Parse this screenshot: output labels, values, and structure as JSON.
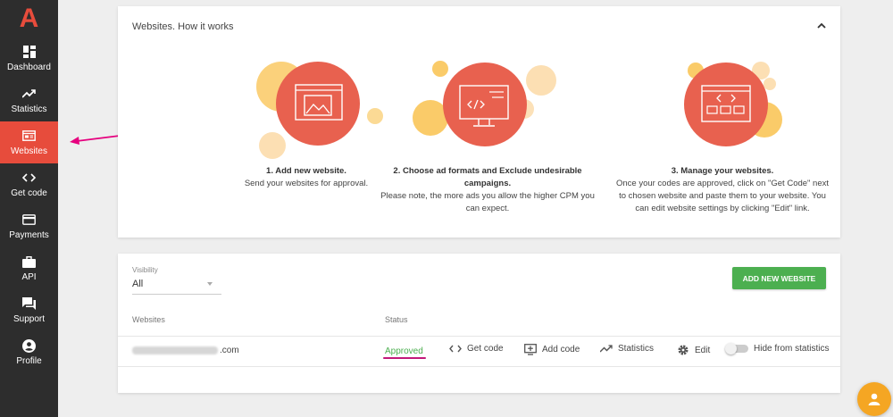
{
  "brand": {
    "logo_letter": "A",
    "accent": "#e74c3c"
  },
  "sidebar": {
    "items": [
      {
        "label": "Dashboard",
        "icon": "dashboard-icon",
        "active": false
      },
      {
        "label": "Statistics",
        "icon": "statistics-icon",
        "active": false
      },
      {
        "label": "Websites",
        "icon": "websites-icon",
        "active": true
      },
      {
        "label": "Get code",
        "icon": "code-icon",
        "active": false
      },
      {
        "label": "Payments",
        "icon": "payments-icon",
        "active": false
      },
      {
        "label": "API",
        "icon": "api-icon",
        "active": false
      },
      {
        "label": "Support",
        "icon": "support-icon",
        "active": false
      },
      {
        "label": "Profile",
        "icon": "profile-icon",
        "active": false
      }
    ]
  },
  "how_it_works": {
    "title": "Websites. How it works",
    "steps": [
      {
        "title": "1. Add new website.",
        "body": "Send your websites for approval."
      },
      {
        "title": "2. Choose ad formats and Exclude undesirable campaigns.",
        "body": "Please note, the more ads you allow the higher CPM you can expect."
      },
      {
        "title": "3. Manage your websites.",
        "body": "Once your codes are approved, click on \"Get Code\" next to chosen website and paste them to your website. You can edit website settings by clicking \"Edit\" link."
      }
    ]
  },
  "websites": {
    "visibility_label": "Visibility",
    "visibility_value": "All",
    "add_button": "ADD NEW WEBSITE",
    "columns": {
      "websites": "Websites",
      "status": "Status"
    },
    "rows": [
      {
        "domain_suffix": ".com",
        "status": "Approved",
        "actions": {
          "get_code": "Get code",
          "add_code": "Add code",
          "statistics": "Statistics",
          "edit": "Edit",
          "hide": "Hide from statistics"
        }
      }
    ]
  },
  "colors": {
    "sidebar_bg": "#2d2d2d",
    "approved": "#4caf50",
    "add_button": "#4caf50",
    "annotation": "#e6007e",
    "fab": "#f5a623"
  }
}
